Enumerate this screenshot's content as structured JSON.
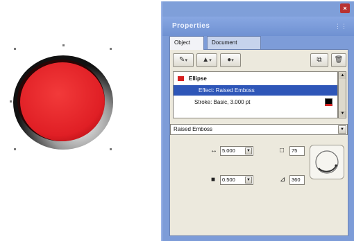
{
  "panel": {
    "header_title": "Properties",
    "grip": "⋮⋮",
    "close_glyph": "×"
  },
  "tabs": [
    {
      "label": "Object",
      "active": true
    },
    {
      "label": "Document",
      "active": false
    }
  ],
  "toolbar": {
    "add_stroke_glyph": "✎",
    "add_fill_glyph": "▲",
    "add_effect_glyph": "●",
    "caret": "▾",
    "duplicate_glyph": "⧉",
    "delete_glyph": "🗑"
  },
  "effects_list": {
    "rows": [
      {
        "label": "Ellipse"
      },
      {
        "label": "Effect: Raised Emboss"
      },
      {
        "label": "Stroke: Basic, 3.000 pt"
      }
    ]
  },
  "effect_dropdown": {
    "selected": "Raised Emboss"
  },
  "params": {
    "width_value": "5.000",
    "softness_value": "0.500",
    "contrast_value": "75",
    "angle_value": "360"
  },
  "colors": {
    "button_red": "#e01f25",
    "panel_blue": "#7d9cd8",
    "selection_blue": "#2e56b8"
  }
}
